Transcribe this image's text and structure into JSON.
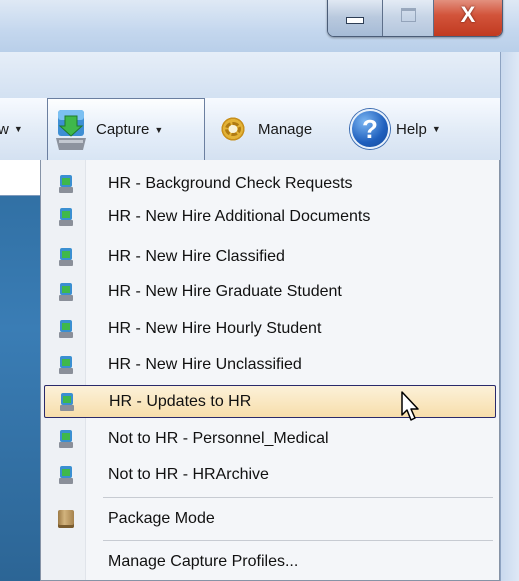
{
  "window": {
    "close_glyph": "X"
  },
  "toolbar": {
    "prev_label": "w",
    "capture_label": "Capture",
    "manage_label": "Manage",
    "help_label": "Help",
    "dropdown_arrow": "▼"
  },
  "menu": {
    "profiles": [
      "HR - Background Check Requests",
      "HR - New Hire Additional Documents",
      "HR - New Hire Classified",
      "HR - New Hire Graduate Student",
      "HR - New Hire Hourly Student",
      "HR - New Hire Unclassified",
      "HR - Updates to HR",
      "Not to HR - Personnel_Medical",
      "Not to HR - HRArchive"
    ],
    "highlighted_index": 6,
    "package_mode": "Package Mode",
    "manage_profiles": "Manage Capture Profiles..."
  },
  "colors": {
    "highlight_bg": "#f7deab",
    "highlight_border": "#2a2a6b",
    "close_button": "#d2543b"
  }
}
